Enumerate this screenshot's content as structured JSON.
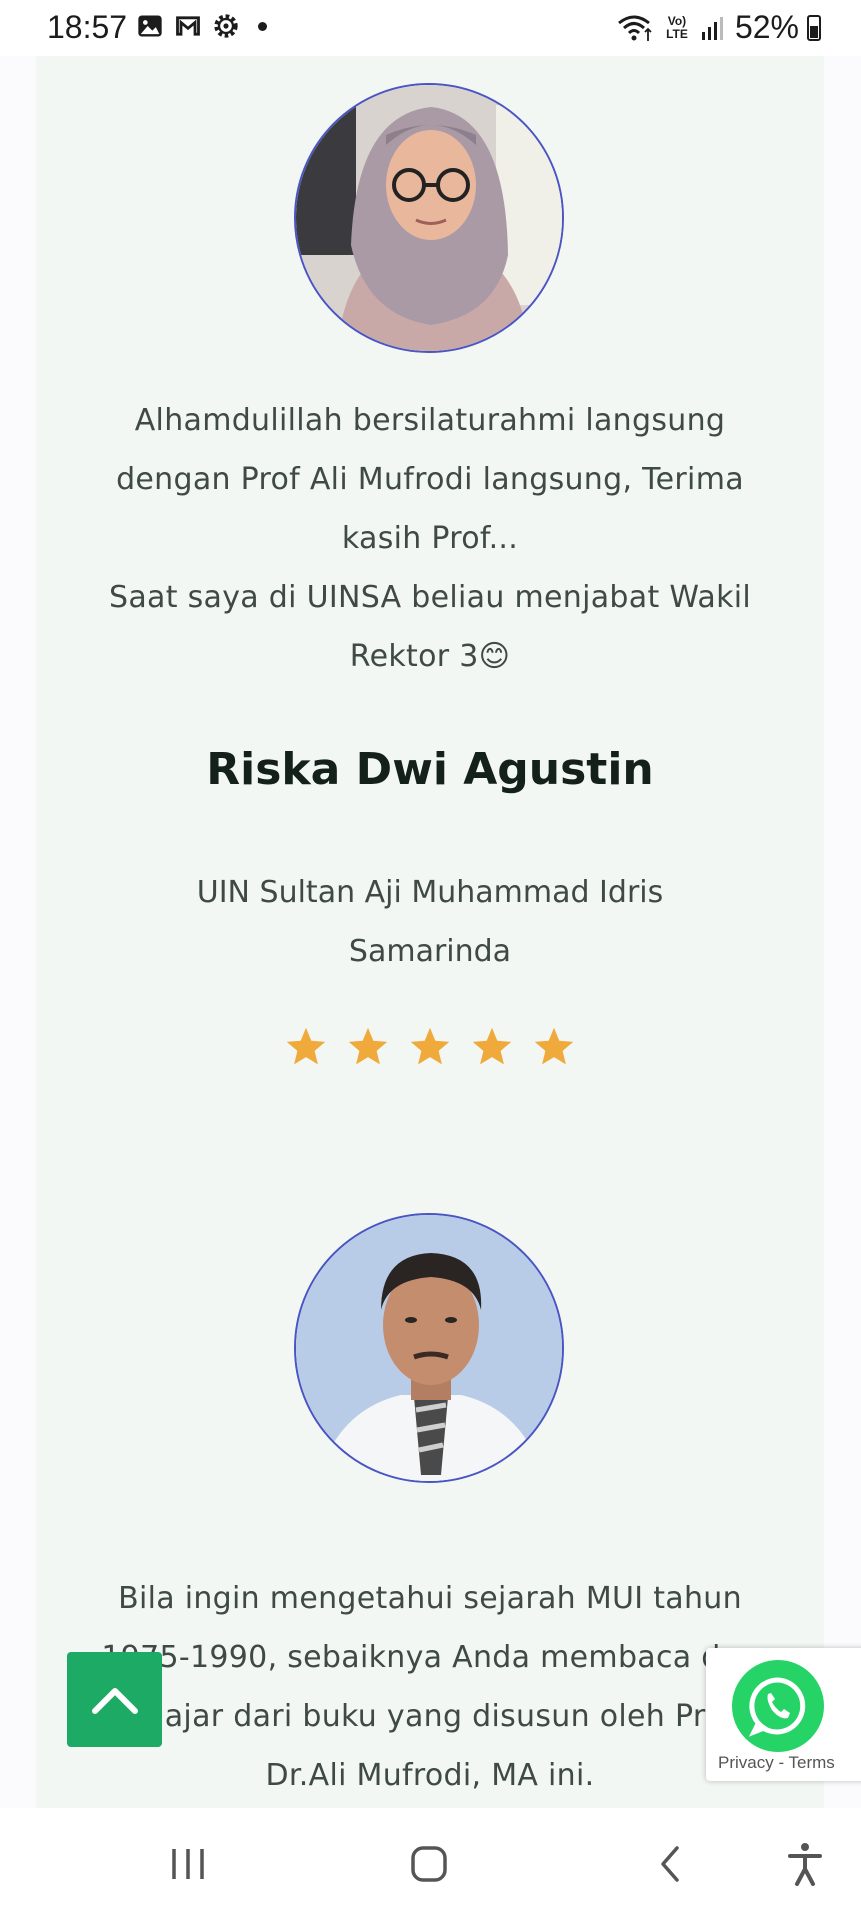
{
  "status_bar": {
    "time": "18:57",
    "battery": "52%",
    "left_icons": [
      "gallery-icon",
      "gmail-icon",
      "settings-icon"
    ],
    "right_icons": [
      "wifi-icon",
      "volte-icon",
      "signal-icon",
      "battery-icon"
    ],
    "network_label": "Vo) LTE"
  },
  "testimonials": [
    {
      "quote_lines": [
        "Alhamdulillah bersilaturahmi langsung",
        "dengan Prof Ali Mufrodi langsung, Terima",
        "kasih Prof...",
        "Saat saya di UINSA beliau menjabat Wakil",
        "Rektor 3😊"
      ],
      "name": "Riska Dwi Agustin",
      "institution_lines": [
        "UIN Sultan Aji Muhammad Idris",
        "Samarinda"
      ],
      "rating": 5
    },
    {
      "quote_lines": [
        "Bila ingin mengetahui sejarah MUI tahun",
        "1975-1990, sebaiknya Anda membaca dan",
        "belajar dari buku yang disusun oleh Prof.",
        "Dr.Ali Mufrodi, MA ini."
      ]
    }
  ],
  "recaptcha": {
    "links": "Privacy - Terms"
  },
  "colors": {
    "accent_green": "#1daa64",
    "star": "#f0a93b",
    "whatsapp": "#25d366",
    "avatar_border": "#4a55c4"
  }
}
